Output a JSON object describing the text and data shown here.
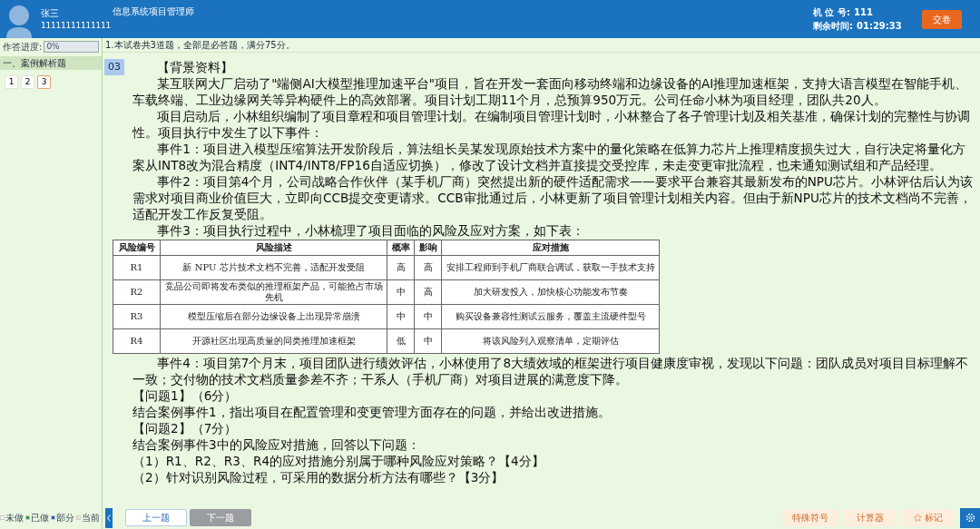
{
  "header": {
    "user_name": "张三",
    "user_id": "11111111111111",
    "exam_title": "信息系统项目管理师",
    "seat_label": "机 位 号:",
    "seat_number": "111",
    "time_label": "剩余时间:",
    "time_left": "01:29:33",
    "submit_button": "交卷"
  },
  "sidebar": {
    "progress_label": "作答进度:",
    "progress_value": "0%",
    "section_title": "一、案例解析题",
    "questions": [
      {
        "label": "1",
        "selected": false
      },
      {
        "label": "2",
        "selected": false
      },
      {
        "label": "3",
        "selected": true
      }
    ],
    "legend": [
      {
        "label": "未做",
        "color": "#ffffff"
      },
      {
        "label": "已做",
        "color": "#1f9d3a"
      },
      {
        "label": "部分",
        "color": "#1a5fd0"
      },
      {
        "label": "当前",
        "color": "#fde3c8"
      }
    ]
  },
  "notice": "1.本试卷共3道题，全部是必答题，满分75分。",
  "question": {
    "number": "03",
    "blocks": [
      {
        "kind": "indent",
        "text": "【背景资料】"
      },
      {
        "kind": "indent",
        "text": "某互联网大厂启动了\"端侧AI大模型推理加速平台\"项目，旨在开发一套面向移动终端和边缘设备的AI推理加速框架，支持大语言模型在智能手机、车载终端、工业边缘网关等异构硬件上的高效部署。项目计划工期11个月，总预算950万元。公司任命小林为项目经理，团队共20人。"
      },
      {
        "kind": "indent",
        "text": "项目启动后，小林组织编制了项目章程和项目管理计划。在编制项目管理计划时，小林整合了各子管理计划及相关基准，确保计划的完整性与协调性。项目执行中发生了以下事件："
      },
      {
        "kind": "indent",
        "text": "事件1：项目进入模型压缩算法开发阶段后，算法组长吴某发现原始技术方案中的量化策略在低算力芯片上推理精度损失过大，自行决定将量化方案从INT8改为混合精度（INT4/INT8/FP16自适应切换），修改了设计文档并直接提交受控库，未走变更审批流程，也未通知测试组和产品经理。"
      },
      {
        "kind": "indent",
        "text": "事件2：项目第4个月，公司战略合作伙伴（某手机厂商）突然提出新的硬件适配需求——要求平台兼容其最新发布的NPU芯片。小林评估后认为该需求对项目商业价值巨大，立即向CCB提交变更请求。CCB审批通过后，小林更新了项目管理计划相关内容。但由于新NPU芯片的技术文档尚不完善，适配开发工作反复受阻。"
      },
      {
        "kind": "indent",
        "text": "事件3：项目执行过程中，小林梳理了项目面临的风险及应对方案，如下表："
      },
      {
        "kind": "table",
        "columns": [
          "风险编号",
          "风险描述",
          "概率",
          "影响",
          "应对措施"
        ],
        "rows": [
          [
            "R1",
            "新 NPU 芯片技术文档不完善，适配开发受阻",
            "高",
            "高",
            "安排工程师到手机厂商联合调试，获取一手技术支持"
          ],
          [
            "R2",
            "竞品公司即将发布类似的推理框架产品，可能抢占市场先机",
            "中",
            "高",
            "加大研发投入，加快核心功能发布节奏"
          ],
          [
            "R3",
            "模型压缩后在部分边缘设备上出现异常崩溃",
            "中",
            "中",
            "购买设备兼容性测试云服务，覆盖主流硬件型号"
          ],
          [
            "R4",
            "开源社区出现高质量的同类推理加速框架",
            "低",
            "中",
            "将该风险列入观察清单，定期评估"
          ]
        ]
      },
      {
        "kind": "indent",
        "text": "事件4：项目第7个月末，项目团队进行绩效评估，小林使用了8大绩效域的框架进行项目健康度审视，发现以下问题：团队成员对项目目标理解不一致；交付物的技术文档质量参差不齐；干系人（手机厂商）对项目进展的满意度下降。"
      },
      {
        "kind": "plain",
        "text": "【问题1】（6分）"
      },
      {
        "kind": "plain",
        "text": "结合案例事件1，指出项目在配置管理和变更管理方面存在的问题，并给出改进措施。"
      },
      {
        "kind": "plain",
        "text": "【问题2】（7分）"
      },
      {
        "kind": "plain",
        "text": "结合案例事件3中的风险应对措施，回答以下问题："
      },
      {
        "kind": "plain",
        "text": "（1）R1、R2、R3、R4的应对措施分别属于哪种风险应对策略？【4分】"
      },
      {
        "kind": "plain",
        "text": "（2）针对识别风险过程，可采用的数据分析方法有哪些？【3分】"
      }
    ]
  },
  "footer": {
    "prev_button": {
      "label": "上一题",
      "disabled": false
    },
    "next_button": {
      "label": "下一题",
      "disabled": true
    },
    "tools": [
      {
        "kind": "text",
        "label": "特殊符号"
      },
      {
        "kind": "text",
        "label": "计算器"
      },
      {
        "kind": "star",
        "label": "标记"
      }
    ]
  }
}
